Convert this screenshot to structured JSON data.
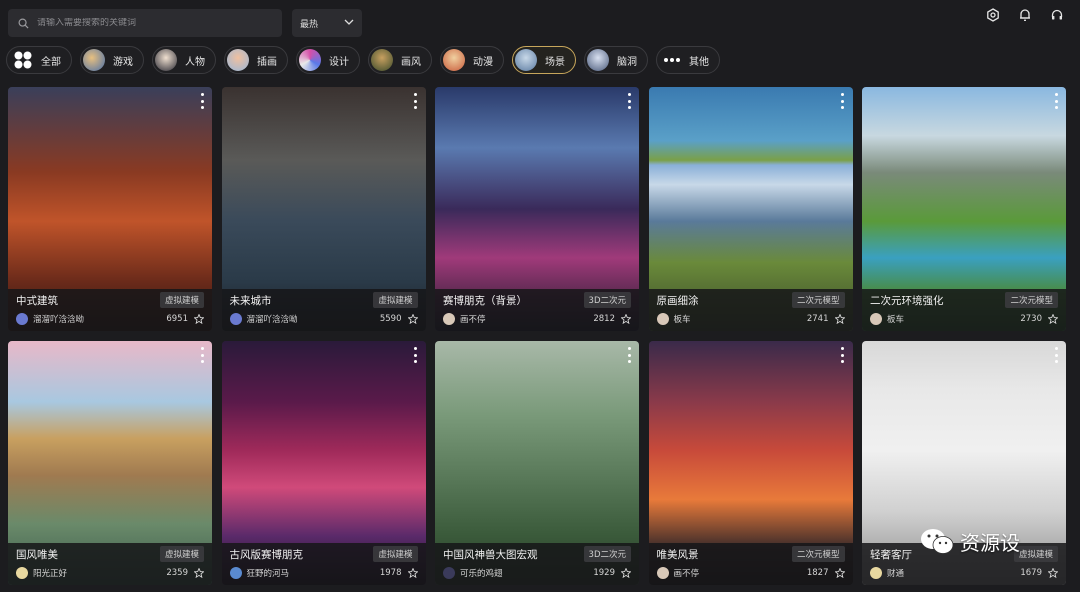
{
  "search": {
    "placeholder": "请输入需要搜索的关键词"
  },
  "sort": {
    "value": "最热"
  },
  "categories": [
    {
      "label": "全部",
      "icon": "grid-icon",
      "active": false
    },
    {
      "label": "游戏",
      "icon": "avatar",
      "color": "#4a6fa8",
      "active": false
    },
    {
      "label": "人物",
      "icon": "avatar",
      "color": "#3a3a44",
      "active": false
    },
    {
      "label": "插画",
      "icon": "avatar",
      "color": "#9ab7d8",
      "active": false
    },
    {
      "label": "设计",
      "icon": "avatar",
      "color": "#d64fa8",
      "active": false
    },
    {
      "label": "画风",
      "icon": "avatar",
      "color": "#6b7a4a",
      "active": false
    },
    {
      "label": "动漫",
      "icon": "avatar",
      "color": "#c85a3a",
      "active": false
    },
    {
      "label": "场景",
      "icon": "avatar",
      "color": "#5a7aa0",
      "active": true
    },
    {
      "label": "脑洞",
      "icon": "avatar",
      "color": "#4a5a7a",
      "active": false
    },
    {
      "label": "其他",
      "icon": "dots-icon",
      "active": false
    }
  ],
  "cards": [
    {
      "title": "中式建筑",
      "tag": "虚拟建模",
      "author": "溜溜吖浛浛呦",
      "count": "6951",
      "bg": "linear-gradient(180deg,#3a3f5a 0%,#8a3a22 35%,#c0542a 55%,#6a2a1a 80%,#2a1610 100%)",
      "ua": "#6a7ad0"
    },
    {
      "title": "未来城市",
      "tag": "虚拟建模",
      "author": "溜溜吖浛浛呦",
      "count": "5590",
      "bg": "linear-gradient(180deg,#3a3230 0%,#5a5a58 30%,#3a4a5a 55%,#2a3a48 80%,#1a1c20 100%)",
      "ua": "#6a7ad0"
    },
    {
      "title": "赛博朋克（背景）",
      "tag": "3D二次元",
      "author": "画不停",
      "count": "2812",
      "bg": "linear-gradient(180deg,#2a3a6a 0%,#5a7ab0 25%,#3a2a5a 50%,#a03a7a 70%,#1a1a2a 100%)",
      "ua": "#d8c8b8"
    },
    {
      "title": "原画细涂",
      "tag": "二次元模型",
      "author": "板车",
      "count": "2741",
      "bg": "linear-gradient(180deg,#3a7ab0 0%,#5aa0c8 22%,#7aa048 30%,#8ab0d8 32%,#c8d8e8 40%,#5a7a9a 55%,#6a8a3a 72%,#3a4a2a 100%)",
      "ua": "#d8c8b8"
    },
    {
      "title": "二次元环境强化",
      "tag": "二次元模型",
      "author": "板车",
      "count": "2730",
      "bg": "linear-gradient(180deg,#8ab8e0 0%,#c8d8e0 20%,#7a8a7a 35%,#5a9a3a 55%,#3aa0c0 70%,#4a8a3a 85%,#2a5a2a 100%)",
      "ua": "#d8c8b8"
    },
    {
      "title": "国风唯美",
      "tag": "虚拟建模",
      "author": "阳光正好",
      "count": "2359",
      "bg": "linear-gradient(180deg,#e8b8c8 0%,#a8c8e0 25%,#c8a060 40%,#a07a50 55%,#6a8a6a 75%,#3a5a4a 100%)",
      "ua": "#e8d8a0"
    },
    {
      "title": "古风版赛博朋克",
      "tag": "虚拟建模",
      "author": "狂野的河马",
      "count": "1978",
      "bg": "linear-gradient(180deg,#2a1a3a 0%,#5a1a4a 25%,#a02a5a 45%,#d04a7a 60%,#5a2a6a 80%,#1a1020 100%)",
      "ua": "#5a8ad0"
    },
    {
      "title": "中国风神兽大图宏观",
      "tag": "3D二次元",
      "author": "可乐的鸡翅",
      "count": "1929",
      "bg": "linear-gradient(180deg,#a8b8a8 0%,#7a9a7a 30%,#5a7a5a 55%,#3a5a3a 80%,#2a3a2a 100%)",
      "ua": "#3a3a5a"
    },
    {
      "title": "唯美风景",
      "tag": "二次元模型",
      "author": "画不停",
      "count": "1827",
      "bg": "linear-gradient(180deg,#3a2a4a 0%,#8a3a4a 25%,#c84a3a 45%,#e87a3a 65%,#3a2a2a 85%,#1a1414 100%)",
      "ua": "#d8c8b8"
    },
    {
      "title": "轻奢客厅",
      "tag": "虚拟建模",
      "author": "财通",
      "count": "1679",
      "bg": "linear-gradient(180deg,#d8d8d8 0%,#e8e8e8 20%,#f0f0f0 45%,#d0d0d0 70%,#8a8a8a 100%)",
      "ua": "#e8d8a0"
    }
  ],
  "watermark": {
    "text": "资源设"
  }
}
